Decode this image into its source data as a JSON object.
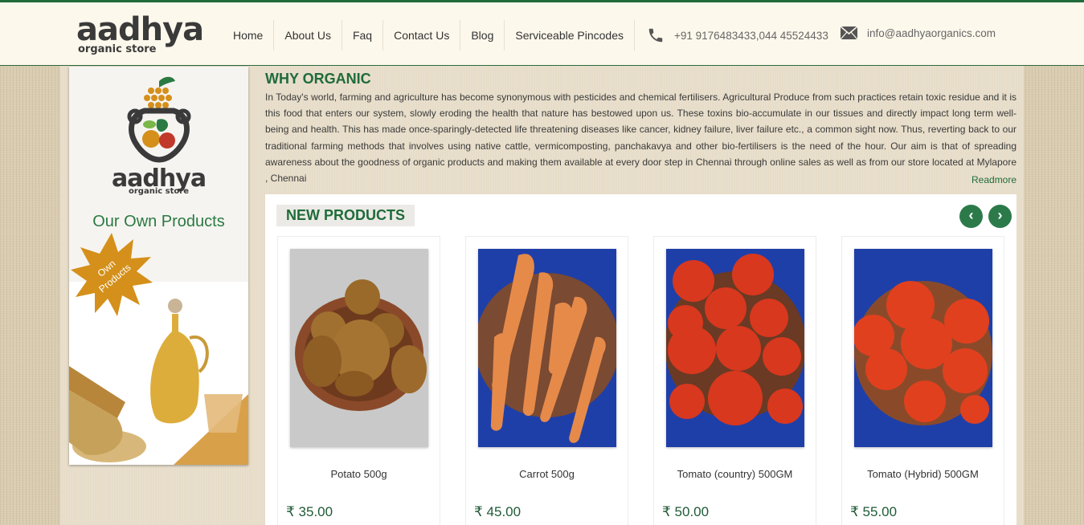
{
  "header": {
    "logo_word": "aadhya",
    "logo_sub": "organic store",
    "nav": [
      "Home",
      "About Us",
      "Faq",
      "Contact Us",
      "Blog",
      "Serviceable Pincodes"
    ],
    "phone": "+91 9176483433,044 45524433",
    "email": "info@aadhyaorganics.com"
  },
  "sidebar": {
    "logo_word": "aadhya",
    "logo_sub": "organic store",
    "title": "Our Own Products",
    "badge_line1": "Own",
    "badge_line2": "Products"
  },
  "why": {
    "title": "WHY ORGANIC",
    "text": "In Today's world, farming and agriculture has become synonymous with pesticides and chemical fertilisers. Agricultural Produce from such practices retain toxic residue and it is this food that enters our system, slowly eroding the health that nature has bestowed upon us. These toxins bio-accumulate in our tissues and directly impact long term well-being and health. This has made once-sparingly-detected life threatening diseases like cancer, kidney failure, liver failure etc., a common sight now. Thus, reverting back to our traditional farming methods that involves using native cattle, vermicomposting, panchakavya and other bio-fertilisers is the need of the hour. Our aim is that of spreading awareness about the goodness of organic products and making them available at every door step in Chennai through online sales as well as from our store located at Mylapore , Chennai",
    "readmore": "Readmore"
  },
  "products": {
    "label": "NEW PRODUCTS",
    "prev": "‹",
    "next": "›",
    "items": [
      {
        "name": "Potato 500g",
        "price": "₹ 35.00"
      },
      {
        "name": "Carrot 500g",
        "price": "₹ 45.00"
      },
      {
        "name": "Tomato (country) 500GM",
        "price": "₹ 50.00"
      },
      {
        "name": "Tomato (Hybrid) 500GM",
        "price": "₹ 55.00"
      }
    ]
  },
  "colors": {
    "brand_green": "#1f6b3a",
    "header_bg": "#fdf8ec",
    "accent_orange": "#d4901a"
  }
}
